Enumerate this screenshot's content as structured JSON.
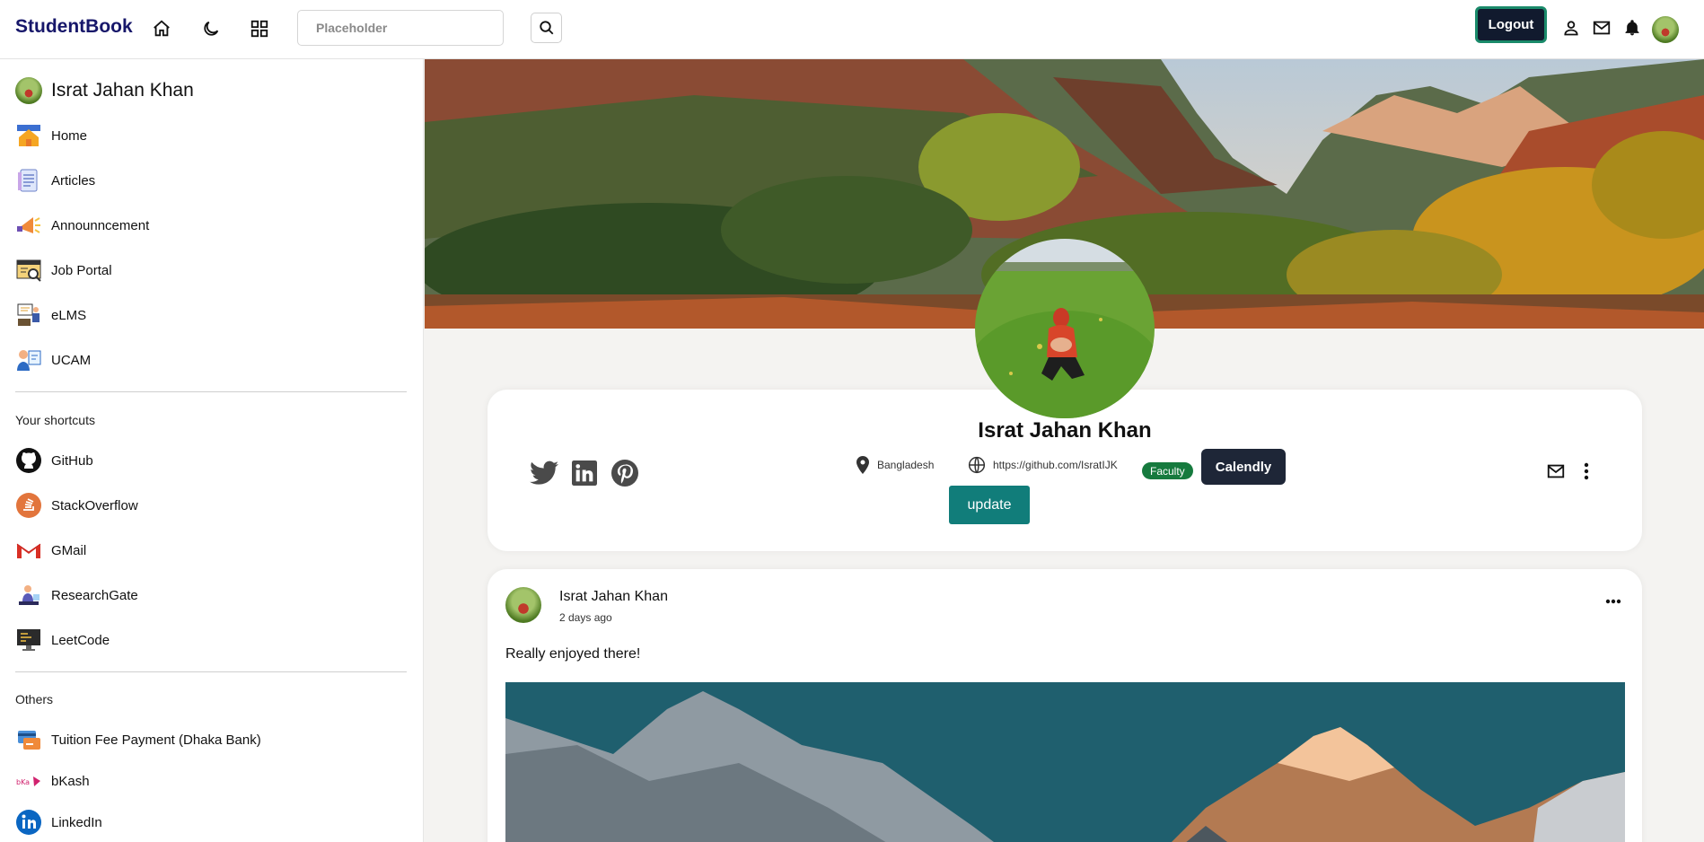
{
  "navbar": {
    "brand": "StudentBook",
    "search_placeholder": "Placeholder",
    "logout_label": "Logout"
  },
  "sidebar": {
    "user_name": "Israt Jahan Khan",
    "main_items": [
      {
        "label": "Home",
        "icon": "home-icon"
      },
      {
        "label": "Articles",
        "icon": "articles-icon"
      },
      {
        "label": "Announncement",
        "icon": "megaphone-icon"
      },
      {
        "label": "Job Portal",
        "icon": "job-portal-icon"
      },
      {
        "label": "eLMS",
        "icon": "elms-icon"
      },
      {
        "label": "UCAM",
        "icon": "ucam-icon"
      }
    ],
    "shortcuts_title": "Your shortcuts",
    "shortcuts": [
      {
        "label": "GitHub",
        "icon": "github-icon"
      },
      {
        "label": "StackOverflow",
        "icon": "stackoverflow-icon"
      },
      {
        "label": "GMail",
        "icon": "gmail-icon"
      },
      {
        "label": "ResearchGate",
        "icon": "researchgate-icon"
      },
      {
        "label": "LeetCode",
        "icon": "leetcode-icon"
      }
    ],
    "others_title": "Others",
    "others": [
      {
        "label": "Tuition Fee Payment (Dhaka Bank)",
        "icon": "payment-card-icon"
      },
      {
        "label": "bKash",
        "icon": "bkash-icon"
      },
      {
        "label": "LinkedIn",
        "icon": "linkedin-icon"
      }
    ]
  },
  "profile": {
    "name": "Israt Jahan Khan",
    "location": "Bangladesh",
    "website": "https://github.com/IsratIJK",
    "role_badge": "Faculty",
    "calendly_label": "Calendly",
    "update_label": "update"
  },
  "post": {
    "author": "Israt Jahan Khan",
    "time": "2 days ago",
    "text": "Really enjoyed there!"
  },
  "colors": {
    "brand": "#17176a",
    "logout_bg": "#111a2e",
    "logout_border": "#1a8a6a",
    "update_bg": "#117d7a",
    "badge_bg": "#167a3e",
    "calendly_bg": "#1e2637"
  }
}
